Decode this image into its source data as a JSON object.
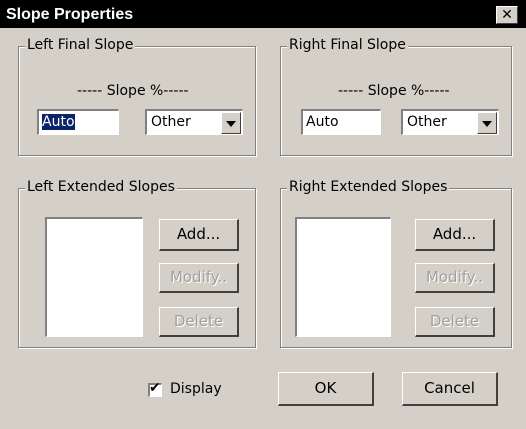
{
  "window": {
    "title": "Slope Properties",
    "close_glyph": "✕"
  },
  "left_final": {
    "legend": "Left Final Slope",
    "slope_label": "----- Slope %-----",
    "value": "Auto",
    "unit_selected": "Other"
  },
  "right_final": {
    "legend": "Right Final Slope",
    "slope_label": "----- Slope %-----",
    "value": "Auto",
    "unit_selected": "Other"
  },
  "left_extended": {
    "legend": "Left Extended Slopes",
    "add_label": "Add...",
    "modify_label": "Modify..",
    "delete_label": "Delete"
  },
  "right_extended": {
    "legend": "Right Extended Slopes",
    "add_label": "Add...",
    "modify_label": "Modify..",
    "delete_label": "Delete"
  },
  "display": {
    "label": "Display",
    "checked": true,
    "check_glyph": "✔"
  },
  "footer": {
    "ok_label": "OK",
    "cancel_label": "Cancel"
  }
}
